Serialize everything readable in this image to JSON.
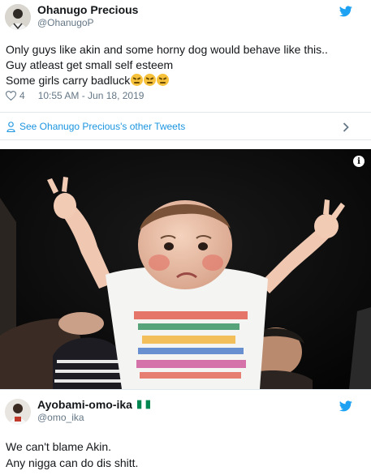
{
  "tweet1": {
    "author_name": "Ohanugo Precious",
    "author_handle": "@OhanugoP",
    "lines": [
      "Only guys like akin and some horny dog would behave like this..",
      "Guy atleast get small self esteem",
      "Some girls carry badluck"
    ],
    "emoji": [
      "confounded-face",
      "confounded-face",
      "confounded-face"
    ],
    "like_count": "4",
    "timestamp": "10:55 AM - Jun 18, 2019",
    "see_more_label": "See Ohanugo Precious's other Tweets"
  },
  "photo": {
    "info_label": "i"
  },
  "tweet2": {
    "author_name": "Ayobami-omo-ika",
    "author_handle": "@omo_ika",
    "lines": [
      "We can't blame Akin.",
      "Any nigga can do dis shitt."
    ],
    "flag": "nigeria-flag"
  },
  "colors": {
    "twitter_blue": "#1da1f2",
    "link_blue": "#1b95e0",
    "secondary_text": "#657786",
    "divider": "#e1e8ed"
  }
}
